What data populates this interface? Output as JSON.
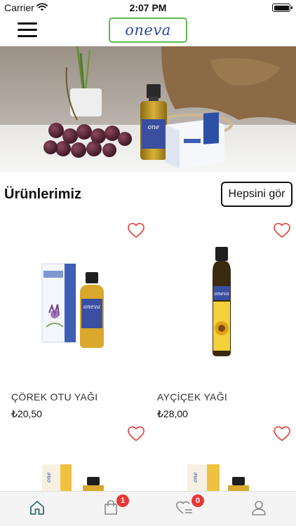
{
  "status_bar": {
    "carrier": "Carrier",
    "time": "2:07 PM"
  },
  "header": {
    "logo_text": "oneva"
  },
  "section": {
    "title": "Ürünlerimiz",
    "see_all_label": "Hepsini gör"
  },
  "products": [
    {
      "name": "ÇÖREK OTU YAĞI",
      "price": "₺20,50",
      "favorite": false
    },
    {
      "name": "AYÇİÇEK YAĞI",
      "price": "₺28,00",
      "favorite": false
    },
    {
      "name": "",
      "price": "",
      "favorite": false
    },
    {
      "name": "",
      "price": "",
      "favorite": false
    }
  ],
  "tab_bar": {
    "items": [
      {
        "icon": "home-icon",
        "active": true
      },
      {
        "icon": "shopping-bag-icon",
        "badge": "1"
      },
      {
        "icon": "favorites-icon",
        "badge": "0"
      },
      {
        "icon": "user-icon"
      }
    ]
  },
  "colors": {
    "accent": "#2f6f6f",
    "logo_border": "#5fb84b",
    "logo_text": "#2e4a9e",
    "heart": "#e53935",
    "badge": "#e53935"
  }
}
